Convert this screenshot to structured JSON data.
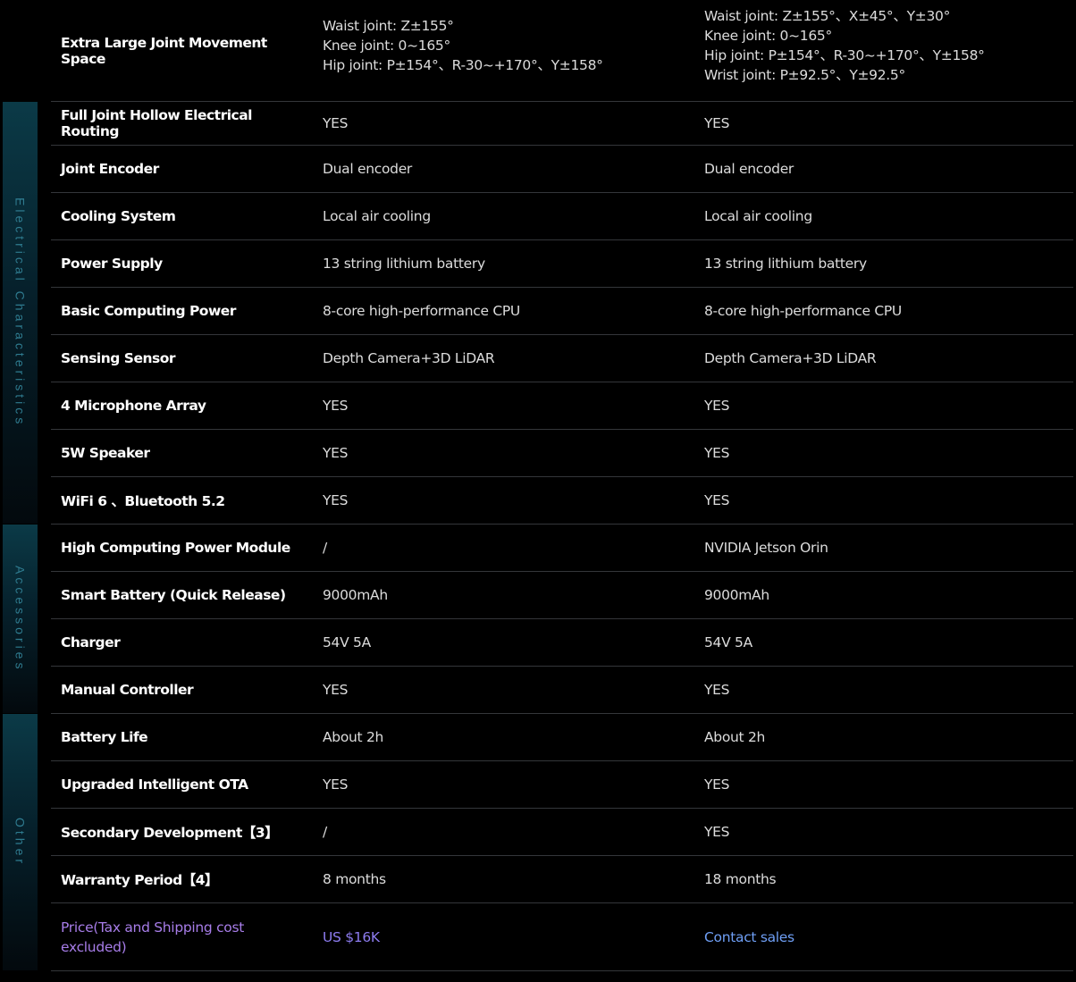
{
  "side_tabs": {
    "electrical": "Electrical Characteristics",
    "accessories": "Accessories",
    "other": "Other"
  },
  "colors": {
    "background": "#000000",
    "row_divider": "#34363a",
    "side_tab": "#0b3a47",
    "side_tab_text": "#2f7c90",
    "price_label": "#a77de8",
    "price_value": "#8d7cf0",
    "price_contact": "#6f9ff5"
  },
  "joint_space": {
    "label": "Extra Large Joint Movement Space",
    "model_a": [
      "Waist joint:  Z±155°",
      "Knee joint:  0~165°",
      "Hip joint:  P±154°、R-30~+170°、Y±158°"
    ],
    "model_b": [
      "Waist joint:  Z±155°、X±45°、Y±30°",
      "Knee joint:  0~165°",
      "Hip joint:  P±154°、R-30~+170°、Y±158°",
      "Wrist joint:  P±92.5°、Y±92.5°"
    ]
  },
  "rows": [
    {
      "label": "Full Joint Hollow Electrical Routing",
      "model_a": "YES",
      "model_b": "YES"
    },
    {
      "label": "Joint Encoder",
      "model_a": "Dual encoder",
      "model_b": "Dual encoder"
    },
    {
      "label": "Cooling System",
      "model_a": "Local air cooling",
      "model_b": "Local air cooling"
    },
    {
      "label": "Power Supply",
      "model_a": "13 string lithium battery",
      "model_b": "13 string lithium battery"
    },
    {
      "label": "Basic Computing Power",
      "model_a": "8-core high-performance CPU",
      "model_b": "8-core high-performance CPU"
    },
    {
      "label": "Sensing Sensor",
      "model_a": "Depth Camera+3D LiDAR",
      "model_b": "Depth Camera+3D LiDAR"
    },
    {
      "label": "4 Microphone Array",
      "model_a": "YES",
      "model_b": "YES"
    },
    {
      "label": "5W Speaker",
      "model_a": "YES",
      "model_b": "YES"
    },
    {
      "label": "WiFi 6 、Bluetooth 5.2",
      "model_a": "YES",
      "model_b": "YES"
    },
    {
      "label": "High Computing Power Module",
      "model_a": "/",
      "model_b": "NVIDIA Jetson Orin"
    },
    {
      "label": "Smart Battery (Quick Release)",
      "model_a": "9000mAh",
      "model_b": "9000mAh"
    },
    {
      "label": "Charger",
      "model_a": "54V 5A",
      "model_b": "54V 5A"
    },
    {
      "label": "Manual Controller",
      "model_a": "YES",
      "model_b": "YES"
    },
    {
      "label": "Battery Life",
      "model_a": "About 2h",
      "model_b": "About 2h"
    },
    {
      "label": "Upgraded Intelligent OTA",
      "model_a": "YES",
      "model_b": "YES"
    },
    {
      "label": "Secondary Development【3】",
      "model_a": "/",
      "model_b": "YES"
    },
    {
      "label": "Warranty Period【4】",
      "model_a": "8 months",
      "model_b": "18 months"
    }
  ],
  "price": {
    "label_line1": "Price(Tax and Shipping cost",
    "label_line2": "excluded)",
    "model_a": "US $16K",
    "model_b": "Contact sales"
  }
}
